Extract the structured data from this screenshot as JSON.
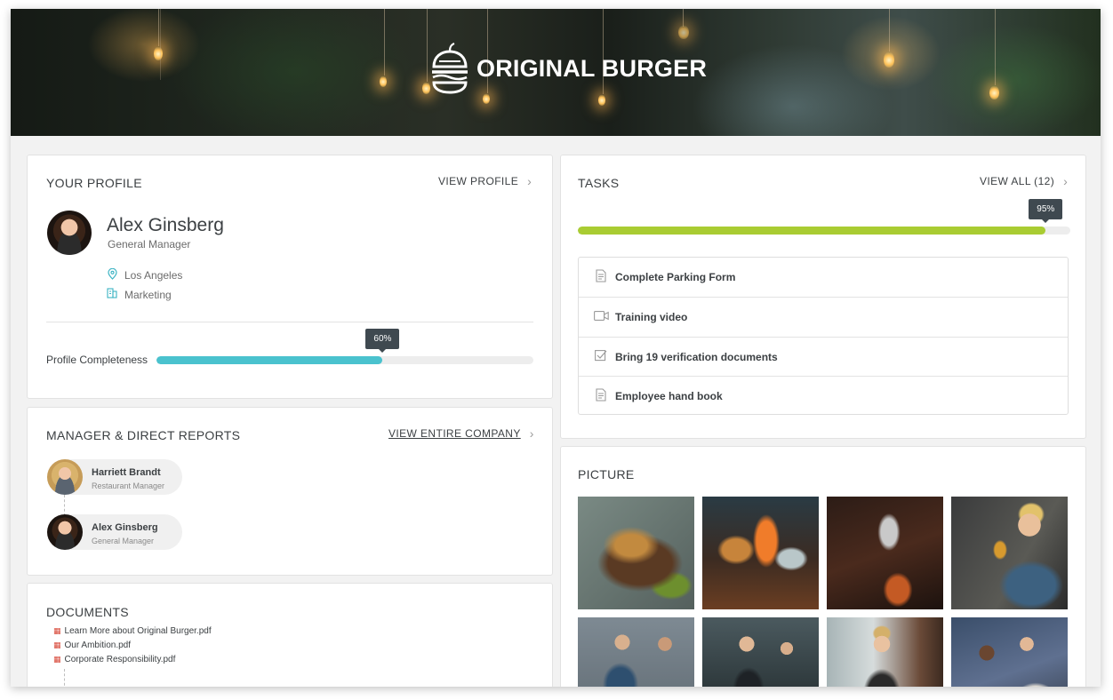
{
  "banner": {
    "brand": "ORIGINAL BURGER"
  },
  "profile": {
    "title": "YOUR PROFILE",
    "view_link": "VIEW  PROFILE",
    "name": "Alex Ginsberg",
    "role": "General Manager",
    "location": "Los Angeles",
    "department": "Marketing",
    "completeness_label": "Profile Completeness",
    "completeness_percent": 60,
    "completeness_text": "60%",
    "accent_color": "#4ac2ce"
  },
  "reports": {
    "title": "MANAGER & DIRECT REPORTS",
    "view_link": "VIEW ENTIRE COMPANY",
    "people": [
      {
        "name": "Harriett Brandt",
        "role": "Restaurant Manager"
      },
      {
        "name": "Alex Ginsberg",
        "role": "General Manager"
      }
    ]
  },
  "documents": {
    "title": "DOCUMENTS",
    "items": [
      "Learn More about Original Burger.pdf",
      "Our Ambition.pdf",
      "Corporate Responsibility.pdf"
    ]
  },
  "tasks": {
    "title": "TASKS",
    "view_link": "VIEW ALL (12)",
    "progress_percent": 95,
    "progress_text": "95%",
    "accent_color": "#a9cc32",
    "items": [
      {
        "label": "Complete Parking Form",
        "icon": "document-icon"
      },
      {
        "label": "Training video",
        "icon": "video-icon"
      },
      {
        "label": "Bring 19 verification documents",
        "icon": "checkbox-icon"
      },
      {
        "label": "Employee hand book",
        "icon": "document-icon"
      }
    ]
  },
  "pictures": {
    "title": "PICTURE",
    "items": [
      "food-photo",
      "burger-photo",
      "beer-tap-photo",
      "bartender-photo",
      "warehouse-photo",
      "waitress-photo",
      "barista-photo",
      "friends-photo"
    ]
  }
}
